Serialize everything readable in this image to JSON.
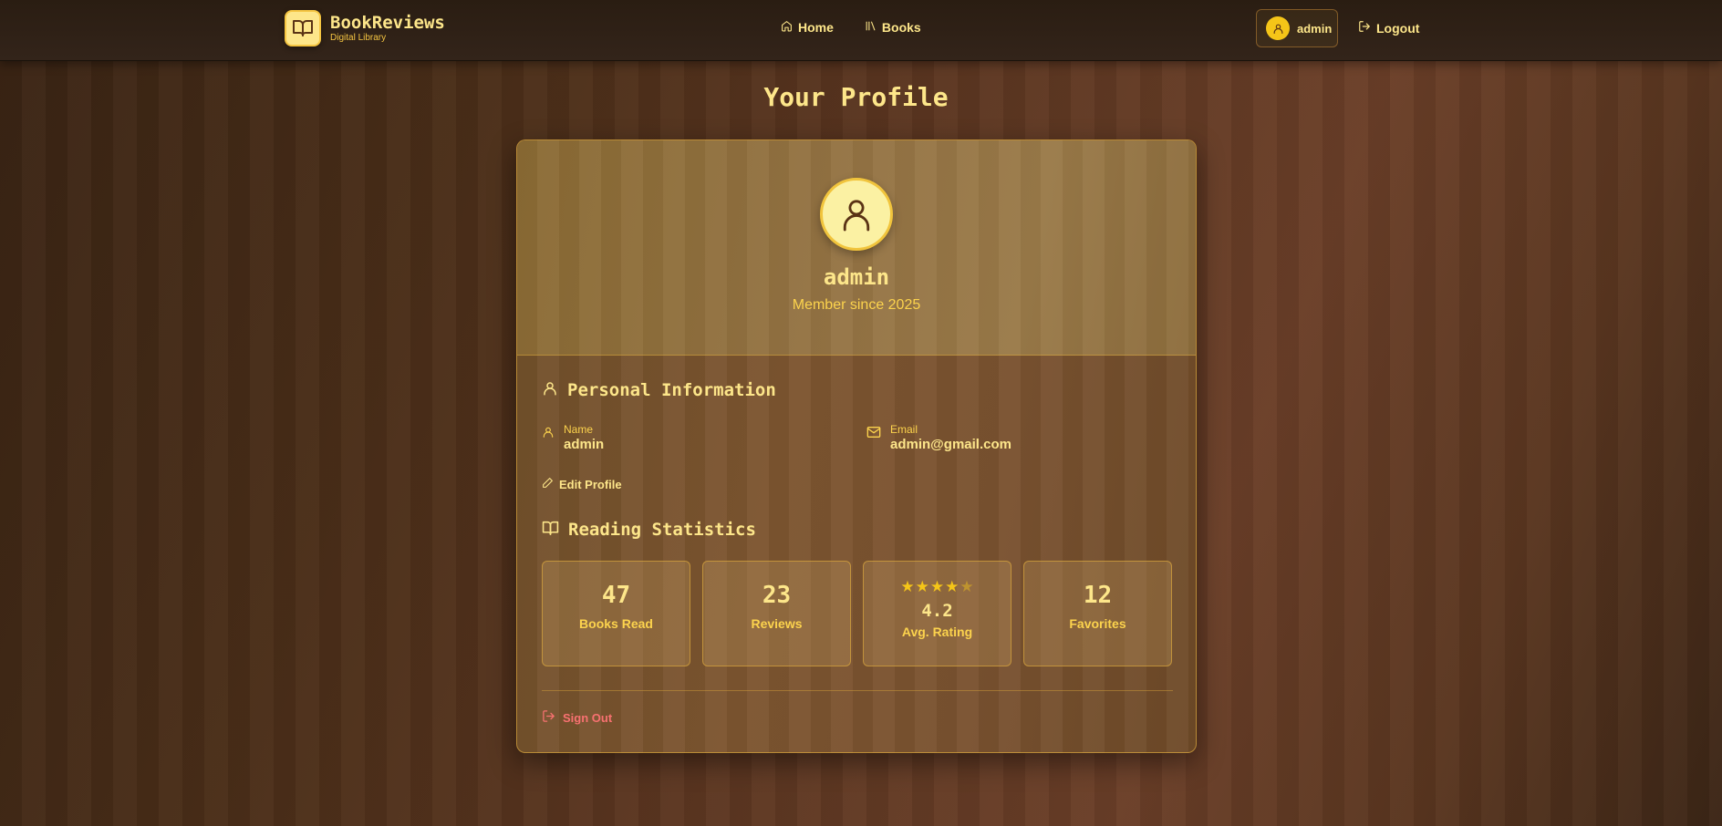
{
  "navbar": {
    "brand_title": "BookReviews",
    "brand_subtitle": "Digital Library",
    "links": [
      {
        "label": "Home",
        "icon": "home-icon"
      },
      {
        "label": "Books",
        "icon": "library-icon"
      }
    ],
    "user_name": "admin",
    "logout_label": "Logout"
  },
  "page": {
    "title": "Your Profile"
  },
  "profile": {
    "name": "admin",
    "member_since": "Member since 2025"
  },
  "personal_info": {
    "title": "Personal Information",
    "name_label": "Name",
    "name_value": "admin",
    "email_label": "Email",
    "email_value": "admin@gmail.com",
    "edit_label": "Edit Profile"
  },
  "stats": {
    "title": "Reading Statistics",
    "items": [
      {
        "value": "47",
        "label": "Books Read"
      },
      {
        "value": "23",
        "label": "Reviews"
      },
      {
        "value": "4.2",
        "label": "Avg. Rating",
        "stars": 4.2
      },
      {
        "value": "12",
        "label": "Favorites"
      }
    ]
  },
  "signout_label": "Sign Out",
  "colors": {
    "accent": "#fde68a",
    "gold": "#f5c518",
    "danger": "#f87171"
  }
}
